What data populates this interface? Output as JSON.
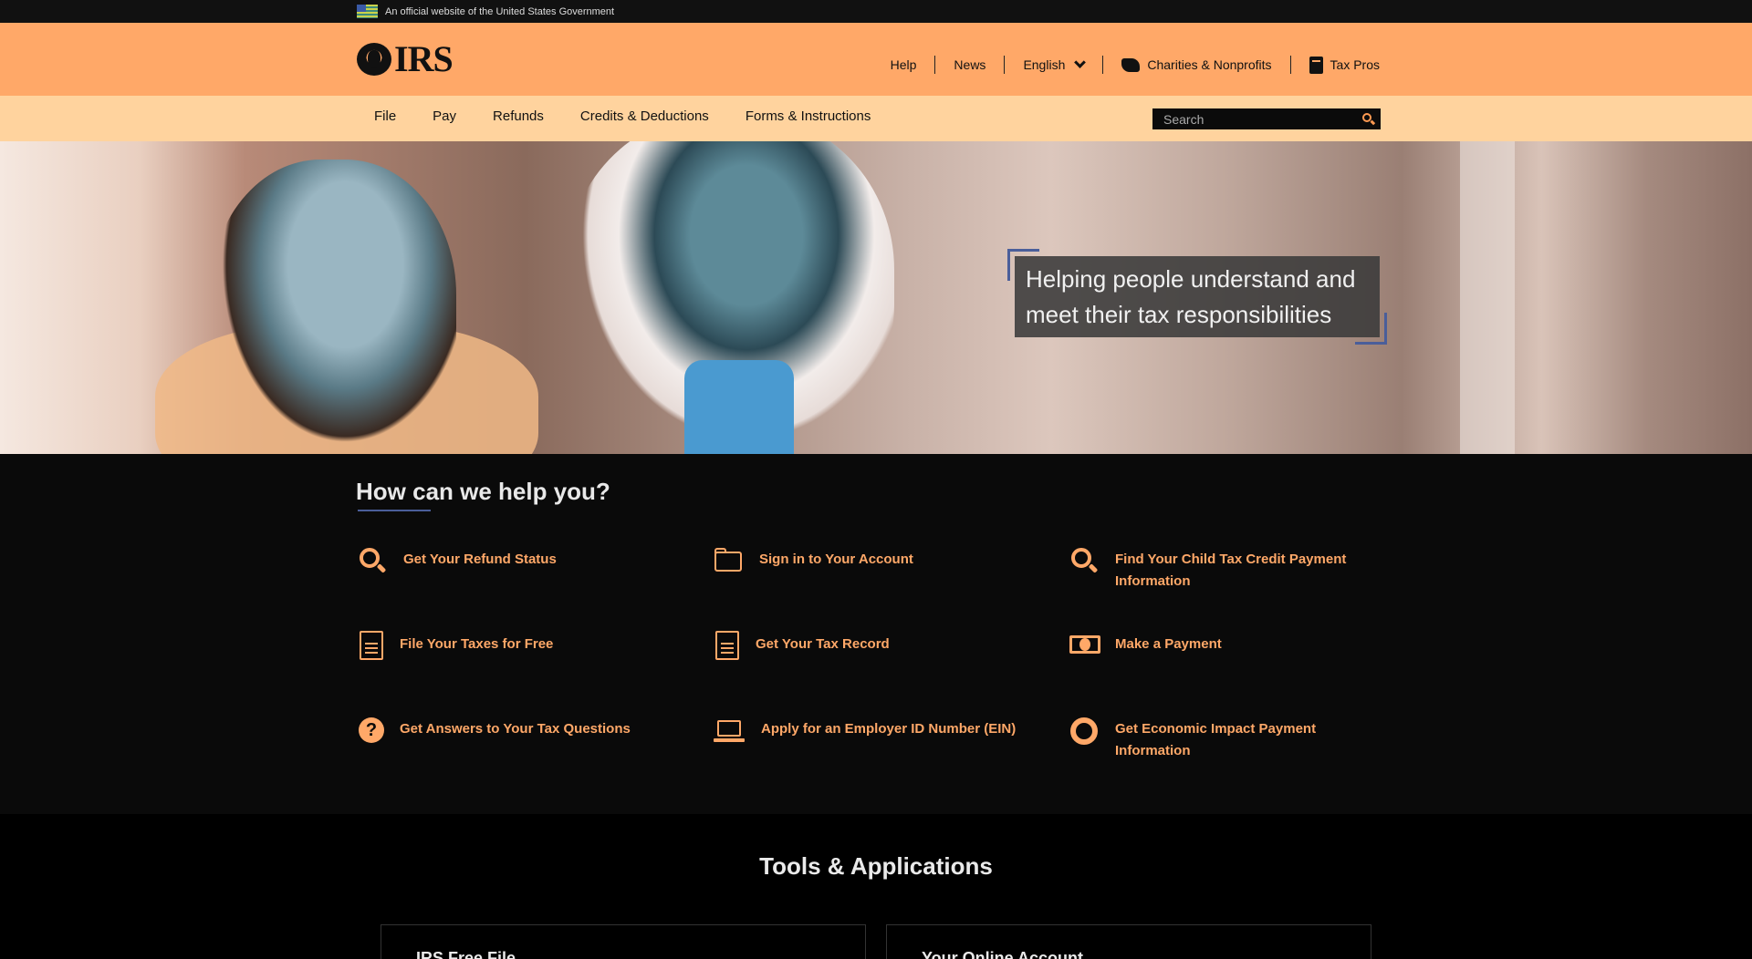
{
  "gov_banner": {
    "text": "An official website of the United States Government"
  },
  "header": {
    "logo_text": "IRS",
    "utility": [
      {
        "label": "Help"
      },
      {
        "label": "News"
      },
      {
        "label": "English",
        "icon": "chevron-down-icon"
      },
      {
        "label": "Charities & Nonprofits",
        "icon": "hand-icon"
      },
      {
        "label": "Tax Pros",
        "icon": "book-icon"
      }
    ]
  },
  "nav": {
    "items": [
      "File",
      "Pay",
      "Refunds",
      "Credits & Deductions",
      "Forms & Instructions"
    ],
    "search_placeholder": "Search"
  },
  "hero": {
    "tagline": "Helping people understand and meet their tax responsibilities"
  },
  "help": {
    "title": "How can we help you?",
    "items": [
      {
        "label": "Get Your Refund Status",
        "icon": "search-icon"
      },
      {
        "label": "Sign in to Your Account",
        "icon": "folder-icon"
      },
      {
        "label": "Find Your Child Tax Credit Payment Information",
        "icon": "search-icon"
      },
      {
        "label": "File Your Taxes for Free",
        "icon": "document-icon"
      },
      {
        "label": "Get Your Tax Record",
        "icon": "document-icon"
      },
      {
        "label": "Make a Payment",
        "icon": "money-icon"
      },
      {
        "label": "Get Answers to Your Tax Questions",
        "icon": "question-icon"
      },
      {
        "label": "Apply for an Employer ID Number (EIN)",
        "icon": "laptop-icon"
      },
      {
        "label": "Get Economic Impact Payment Information",
        "icon": "life-ring-icon"
      }
    ]
  },
  "tools": {
    "title": "Tools & Applications",
    "cards": [
      {
        "label": "IRS Free File"
      },
      {
        "label": "Your Online Account"
      }
    ]
  },
  "colors": {
    "header_bg": "#ffa868",
    "nav_bg": "#ffd39e",
    "accent": "#ffa868",
    "underline": "#4a5e9a"
  }
}
